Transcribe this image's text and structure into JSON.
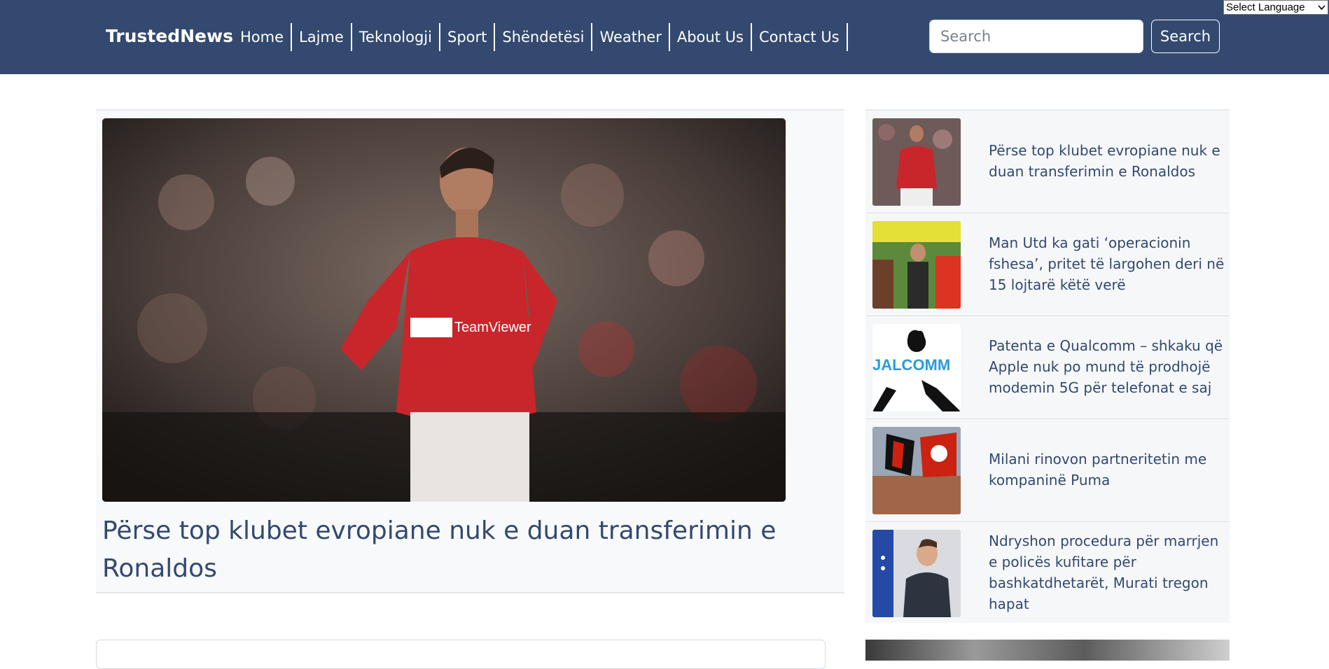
{
  "header": {
    "brand": "TrustedNews",
    "nav": [
      {
        "label": "Home"
      },
      {
        "label": "Lajme"
      },
      {
        "label": "Teknologji"
      },
      {
        "label": "Sport"
      },
      {
        "label": "Shëndetësi"
      },
      {
        "label": "Weather"
      },
      {
        "label": "About Us"
      },
      {
        "label": "Contact Us"
      }
    ],
    "search_placeholder": "Search",
    "search_button": "Search",
    "language_select": "Select Language"
  },
  "featured": {
    "image_icon": "featured-photo",
    "title": "Përse top klubet evropiane nuk e duan transferimin e Ronaldos"
  },
  "sidebar": {
    "items": [
      {
        "title": "Përse top klubet evropiane nuk e duan transferimin e Ronaldos"
      },
      {
        "title": "Man Utd ka gati ‘operacionin fshesa’, pritet të largohen deri në 15 lojtarë këtë verë"
      },
      {
        "title": "Patenta e Qualcomm – shkaku që Apple nuk po mund të prodhojë modemin 5G për telefonat e saj"
      },
      {
        "title": "Milani rinovon partneritetin me kompaninë Puma"
      },
      {
        "title": "Ndryshon procedura për marrjen e policës kufitare për bashkatdhetarët, Murati tregon hapat"
      }
    ]
  },
  "colors": {
    "navbar": "#33496f",
    "title": "#33496f",
    "card_bg": "#f8f9fa"
  }
}
